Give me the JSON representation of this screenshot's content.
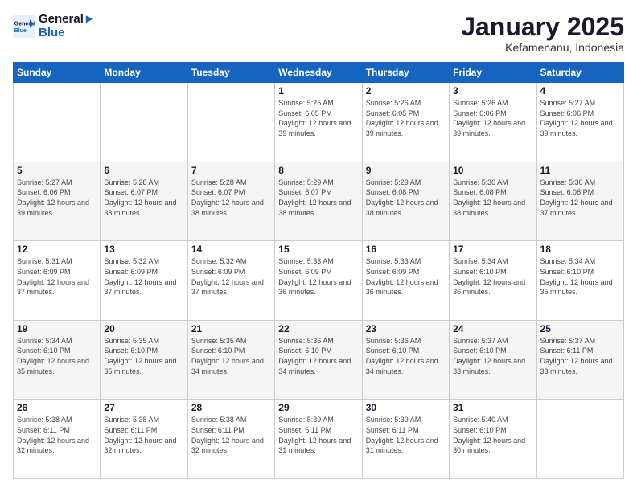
{
  "logo": {
    "line1": "General",
    "line2": "Blue"
  },
  "title": "January 2025",
  "subtitle": "Kefamenanu, Indonesia",
  "days_header": [
    "Sunday",
    "Monday",
    "Tuesday",
    "Wednesday",
    "Thursday",
    "Friday",
    "Saturday"
  ],
  "weeks": [
    [
      {
        "day": "",
        "info": ""
      },
      {
        "day": "",
        "info": ""
      },
      {
        "day": "",
        "info": ""
      },
      {
        "day": "1",
        "info": "Sunrise: 5:25 AM\nSunset: 6:05 PM\nDaylight: 12 hours and 39 minutes."
      },
      {
        "day": "2",
        "info": "Sunrise: 5:26 AM\nSunset: 6:05 PM\nDaylight: 12 hours and 39 minutes."
      },
      {
        "day": "3",
        "info": "Sunrise: 5:26 AM\nSunset: 6:06 PM\nDaylight: 12 hours and 39 minutes."
      },
      {
        "day": "4",
        "info": "Sunrise: 5:27 AM\nSunset: 6:06 PM\nDaylight: 12 hours and 39 minutes."
      }
    ],
    [
      {
        "day": "5",
        "info": "Sunrise: 5:27 AM\nSunset: 6:06 PM\nDaylight: 12 hours and 39 minutes."
      },
      {
        "day": "6",
        "info": "Sunrise: 5:28 AM\nSunset: 6:07 PM\nDaylight: 12 hours and 38 minutes."
      },
      {
        "day": "7",
        "info": "Sunrise: 5:28 AM\nSunset: 6:07 PM\nDaylight: 12 hours and 38 minutes."
      },
      {
        "day": "8",
        "info": "Sunrise: 5:29 AM\nSunset: 6:07 PM\nDaylight: 12 hours and 38 minutes."
      },
      {
        "day": "9",
        "info": "Sunrise: 5:29 AM\nSunset: 6:08 PM\nDaylight: 12 hours and 38 minutes."
      },
      {
        "day": "10",
        "info": "Sunrise: 5:30 AM\nSunset: 6:08 PM\nDaylight: 12 hours and 38 minutes."
      },
      {
        "day": "11",
        "info": "Sunrise: 5:30 AM\nSunset: 6:08 PM\nDaylight: 12 hours and 37 minutes."
      }
    ],
    [
      {
        "day": "12",
        "info": "Sunrise: 5:31 AM\nSunset: 6:09 PM\nDaylight: 12 hours and 37 minutes."
      },
      {
        "day": "13",
        "info": "Sunrise: 5:32 AM\nSunset: 6:09 PM\nDaylight: 12 hours and 37 minutes."
      },
      {
        "day": "14",
        "info": "Sunrise: 5:32 AM\nSunset: 6:09 PM\nDaylight: 12 hours and 37 minutes."
      },
      {
        "day": "15",
        "info": "Sunrise: 5:33 AM\nSunset: 6:09 PM\nDaylight: 12 hours and 36 minutes."
      },
      {
        "day": "16",
        "info": "Sunrise: 5:33 AM\nSunset: 6:09 PM\nDaylight: 12 hours and 36 minutes."
      },
      {
        "day": "17",
        "info": "Sunrise: 5:34 AM\nSunset: 6:10 PM\nDaylight: 12 hours and 36 minutes."
      },
      {
        "day": "18",
        "info": "Sunrise: 5:34 AM\nSunset: 6:10 PM\nDaylight: 12 hours and 35 minutes."
      }
    ],
    [
      {
        "day": "19",
        "info": "Sunrise: 5:34 AM\nSunset: 6:10 PM\nDaylight: 12 hours and 35 minutes."
      },
      {
        "day": "20",
        "info": "Sunrise: 5:35 AM\nSunset: 6:10 PM\nDaylight: 12 hours and 35 minutes."
      },
      {
        "day": "21",
        "info": "Sunrise: 5:35 AM\nSunset: 6:10 PM\nDaylight: 12 hours and 34 minutes."
      },
      {
        "day": "22",
        "info": "Sunrise: 5:36 AM\nSunset: 6:10 PM\nDaylight: 12 hours and 34 minutes."
      },
      {
        "day": "23",
        "info": "Sunrise: 5:36 AM\nSunset: 6:10 PM\nDaylight: 12 hours and 34 minutes."
      },
      {
        "day": "24",
        "info": "Sunrise: 5:37 AM\nSunset: 6:10 PM\nDaylight: 12 hours and 33 minutes."
      },
      {
        "day": "25",
        "info": "Sunrise: 5:37 AM\nSunset: 6:11 PM\nDaylight: 12 hours and 33 minutes."
      }
    ],
    [
      {
        "day": "26",
        "info": "Sunrise: 5:38 AM\nSunset: 6:11 PM\nDaylight: 12 hours and 32 minutes."
      },
      {
        "day": "27",
        "info": "Sunrise: 5:38 AM\nSunset: 6:11 PM\nDaylight: 12 hours and 32 minutes."
      },
      {
        "day": "28",
        "info": "Sunrise: 5:38 AM\nSunset: 6:11 PM\nDaylight: 12 hours and 32 minutes."
      },
      {
        "day": "29",
        "info": "Sunrise: 5:39 AM\nSunset: 6:11 PM\nDaylight: 12 hours and 31 minutes."
      },
      {
        "day": "30",
        "info": "Sunrise: 5:39 AM\nSunset: 6:11 PM\nDaylight: 12 hours and 31 minutes."
      },
      {
        "day": "31",
        "info": "Sunrise: 5:40 AM\nSunset: 6:10 PM\nDaylight: 12 hours and 30 minutes."
      },
      {
        "day": "",
        "info": ""
      }
    ]
  ]
}
